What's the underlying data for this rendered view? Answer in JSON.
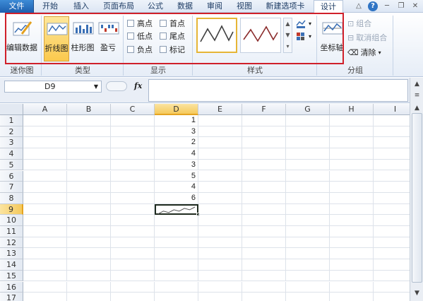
{
  "menu": {
    "file": "文件",
    "tabs": [
      "开始",
      "插入",
      "页面布局",
      "公式",
      "数据",
      "审阅",
      "视图",
      "新建选项卡",
      "设计"
    ]
  },
  "ribbon": {
    "edit_data": "编辑数据",
    "type_line": "折线图",
    "type_column": "柱形图",
    "type_winloss": "盈亏",
    "show": {
      "high": "高点",
      "first": "首点",
      "low": "低点",
      "last": "尾点",
      "negative": "负点",
      "markers": "标记"
    },
    "axis": "坐标轴",
    "group": "组合",
    "ungroup": "取消组合",
    "clear": "清除",
    "groups": {
      "sparkline": "迷你图",
      "type": "类型",
      "show": "显示",
      "style": "样式",
      "group": "分组"
    }
  },
  "formula_bar": {
    "name_box": "D9",
    "fx": "fx",
    "formula": ""
  },
  "sheet": {
    "columns": [
      "A",
      "B",
      "C",
      "D",
      "E",
      "F",
      "G",
      "H",
      "I"
    ],
    "rows": [
      "1",
      "2",
      "3",
      "4",
      "5",
      "6",
      "7",
      "8",
      "9",
      "10",
      "11",
      "12",
      "13",
      "14",
      "15",
      "16",
      "17"
    ],
    "d_values": [
      "1",
      "3",
      "2",
      "4",
      "3",
      "5",
      "4",
      "6"
    ],
    "sparkline_values": [
      1,
      3,
      2,
      4,
      3,
      5,
      4,
      6
    ],
    "selected_column": "D",
    "selected_row": "9"
  },
  "colors": {
    "highlight_border": "#d0202a",
    "selection": "#f5c95c",
    "sparkline": "#555555"
  }
}
